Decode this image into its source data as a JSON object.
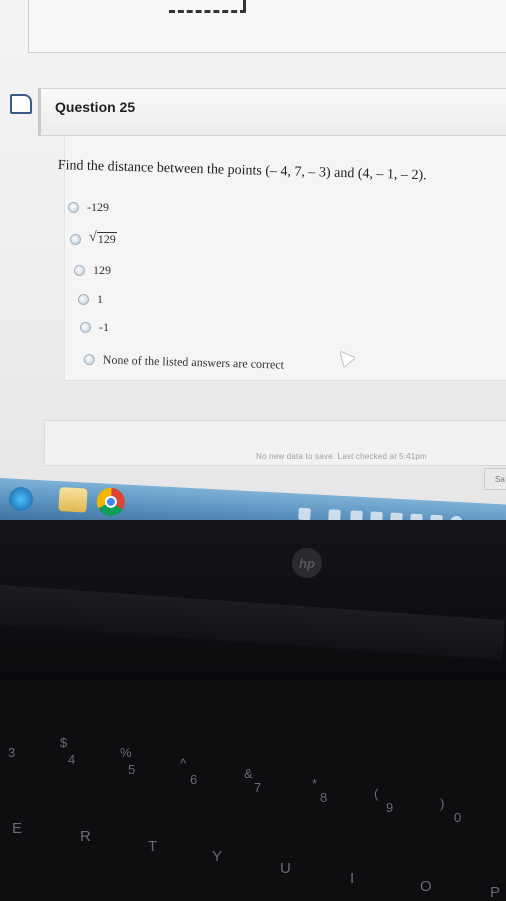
{
  "question": {
    "title": "Question 25",
    "prompt": "Find the distance between the points (– 4, 7, – 3) and (4, – 1, – 2).",
    "choices": [
      {
        "label": "-129",
        "kind": "text"
      },
      {
        "label": "129",
        "kind": "sqrt"
      },
      {
        "label": "129",
        "kind": "text"
      },
      {
        "label": "1",
        "kind": "text"
      },
      {
        "label": "-1",
        "kind": "text"
      },
      {
        "label": "None of the listed answers are correct",
        "kind": "text"
      }
    ]
  },
  "footer": {
    "save_status": "No new data to save. Last checked at 5:41pm",
    "save_label": "Sa"
  },
  "taskbar": {
    "icons": [
      "start-icon",
      "ie-icon",
      "folder-icon",
      "chrome-icon"
    ]
  },
  "keyboard": {
    "brand": "hp",
    "number_row": [
      "3",
      "$",
      "4",
      "%",
      "5",
      "^",
      "6",
      "&",
      "7",
      "*",
      "8",
      "(",
      "9",
      ")",
      "0"
    ],
    "letter_row": [
      "E",
      "R",
      "T",
      "Y",
      "U",
      "I",
      "O",
      "P"
    ]
  },
  "colors": {
    "taskbar": "#5d94c2",
    "screen_bg": "#f0f0f0",
    "radio_fill": "#b9c6d6",
    "bezel": "#0e0d10"
  }
}
